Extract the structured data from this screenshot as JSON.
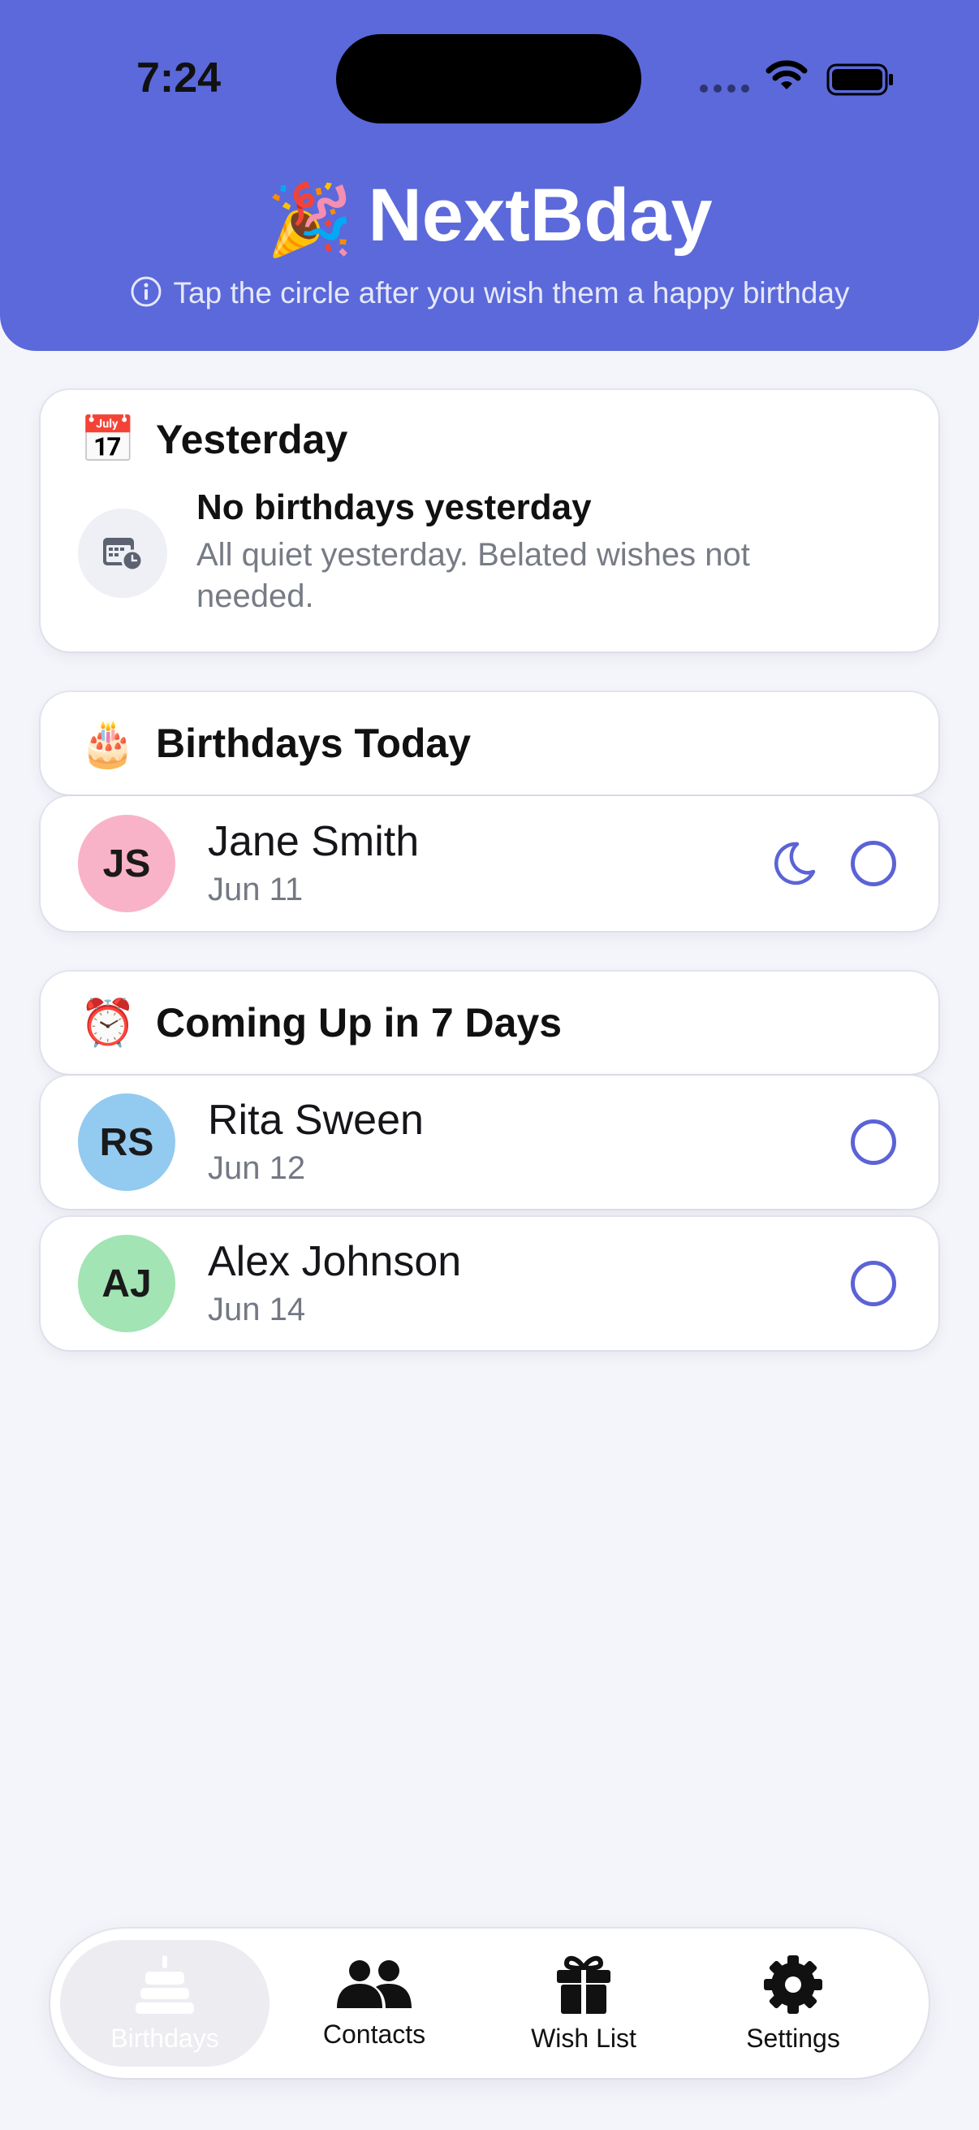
{
  "status_bar": {
    "time": "7:24"
  },
  "header": {
    "emoji": "🎉",
    "title": "NextBday",
    "subtitle": "Tap the circle after you wish them a happy birthday"
  },
  "sections": {
    "yesterday": {
      "emoji": "📅",
      "title": "Yesterday",
      "empty_title": "No birthdays yesterday",
      "empty_desc": "All quiet yesterday. Belated wishes not needed."
    },
    "today": {
      "emoji": "🎂",
      "title": "Birthdays Today",
      "people": [
        {
          "initials": "JS",
          "name": "Jane Smith",
          "date": "Jun 11",
          "avatar_color": "#f9b3c8"
        }
      ]
    },
    "upcoming": {
      "emoji": "⏰",
      "title": "Coming Up in 7 Days",
      "people": [
        {
          "initials": "RS",
          "name": "Rita Sween",
          "date": "Jun 12",
          "avatar_color": "#93caf0"
        },
        {
          "initials": "AJ",
          "name": "Alex Johnson",
          "date": "Jun 14",
          "avatar_color": "#a2e4b3"
        }
      ]
    }
  },
  "tabbar": {
    "tabs": [
      {
        "label": "Birthdays",
        "icon": "cake-icon",
        "active": true
      },
      {
        "label": "Contacts",
        "icon": "people-icon",
        "active": false
      },
      {
        "label": "Wish List",
        "icon": "gift-icon",
        "active": false
      },
      {
        "label": "Settings",
        "icon": "gear-icon",
        "active": false
      }
    ]
  },
  "colors": {
    "header_bg": "#5b69da",
    "accent": "#5b63d6",
    "page_bg": "#f4f5fa"
  }
}
